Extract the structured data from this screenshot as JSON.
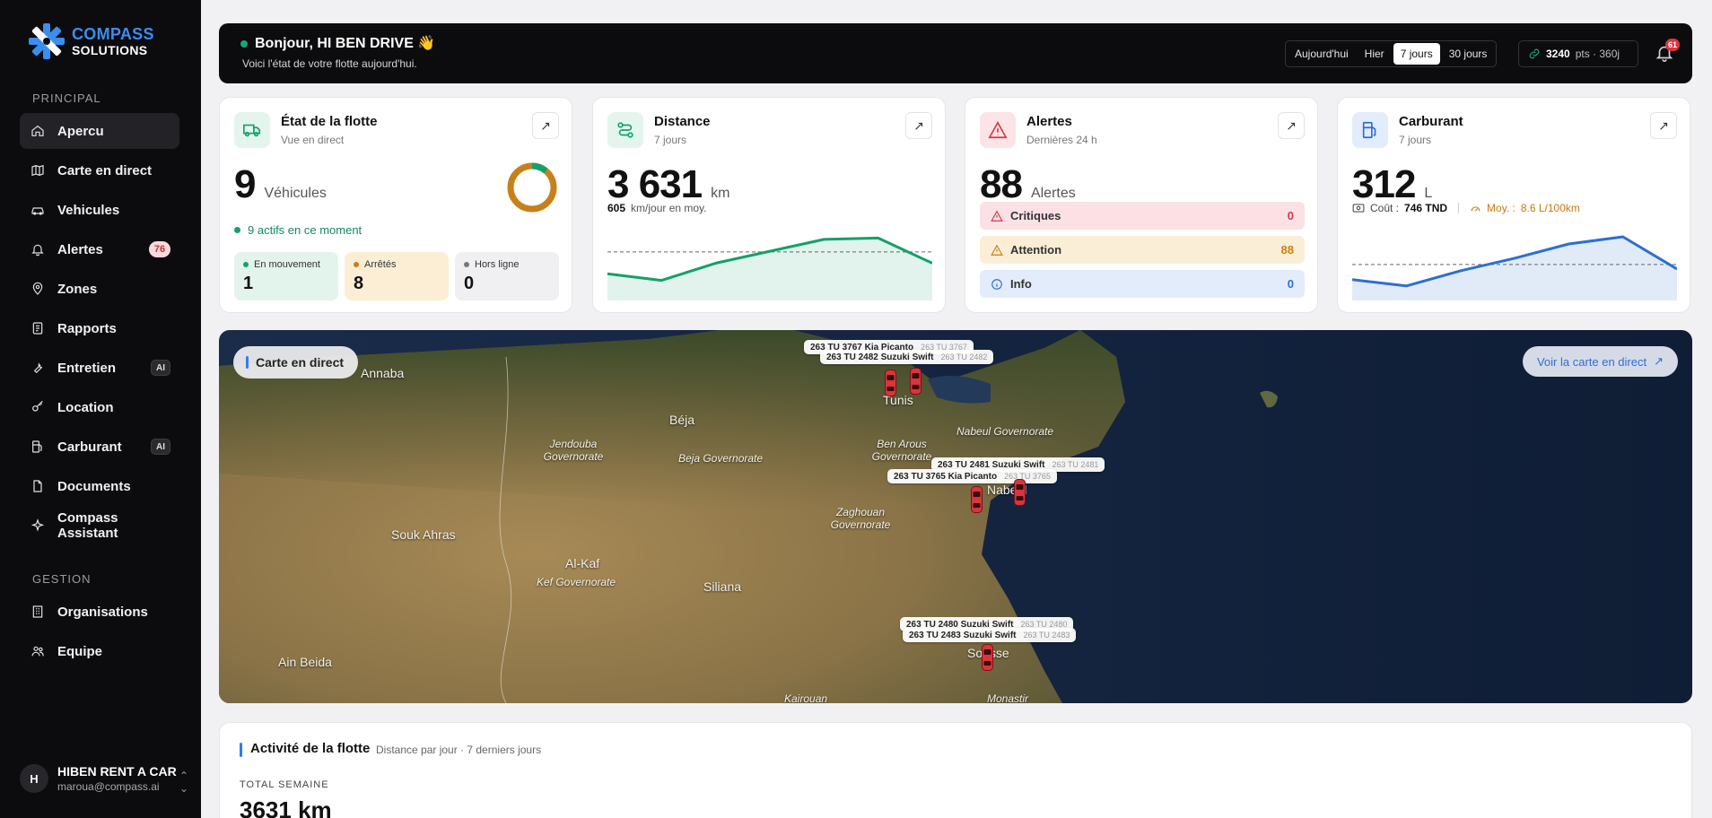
{
  "brand": {
    "line1": "COMPASS",
    "line2": "SOLUTIONS"
  },
  "sidebar": {
    "section_principal": "PRINCIPAL",
    "section_gestion": "GESTION",
    "items": [
      {
        "label": "Apercu",
        "icon": "home-icon"
      },
      {
        "label": "Carte en direct",
        "icon": "map-icon"
      },
      {
        "label": "Vehicules",
        "icon": "car-icon"
      },
      {
        "label": "Alertes",
        "icon": "bell-icon",
        "badge": "76"
      },
      {
        "label": "Zones",
        "icon": "pin-icon"
      },
      {
        "label": "Rapports",
        "icon": "report-icon"
      },
      {
        "label": "Entretien",
        "icon": "wrench-icon",
        "ai": "AI"
      },
      {
        "label": "Location",
        "icon": "key-icon"
      },
      {
        "label": "Carburant",
        "icon": "fuel-icon",
        "ai": "AI"
      },
      {
        "label": "Documents",
        "icon": "document-icon"
      },
      {
        "label": "Compass Assistant",
        "icon": "sparkle-icon"
      }
    ],
    "gestion_items": [
      {
        "label": "Organisations",
        "icon": "building-icon"
      },
      {
        "label": "Equipe",
        "icon": "team-icon"
      }
    ],
    "user": {
      "initial": "H",
      "name": "HIBEN RENT A CAR",
      "email": "maroua@compass.ai"
    }
  },
  "header": {
    "greeting": "Bonjour, HI BEN DRIVE 👋",
    "subtitle": "Voici l'état de votre flotte aujourd'hui.",
    "periods": [
      "Aujourd'hui",
      "Hier",
      "7 jours",
      "30 jours"
    ],
    "selected_period": "7 jours",
    "points_value": "3240",
    "points_unit": "pts · 360j",
    "notifications": "61"
  },
  "fleet": {
    "title": "État de la flotte",
    "subtitle": "Vue en direct",
    "count": "9",
    "unit": "Véhicules",
    "active_text": "9 actifs en ce moment",
    "moving_label": "En mouvement",
    "moving": "1",
    "stopped_label": "Arrêtés",
    "stopped": "8",
    "offline_label": "Hors ligne",
    "offline": "0",
    "moving_fraction": 0.111,
    "colors": {
      "moving": "#16a06a",
      "stopped": "#c7801a",
      "offline": "#777777"
    }
  },
  "distance": {
    "title": "Distance",
    "subtitle": "7 jours",
    "value": "3 631",
    "unit": "km",
    "avg_value": "605",
    "avg_label": "km/jour en moy.",
    "color": "#14a06a",
    "series": [
      440,
      390,
      520,
      610,
      700,
      710,
      520
    ],
    "average": 605
  },
  "alerts": {
    "title": "Alertes",
    "subtitle": "Dernières 24 h",
    "total": "88",
    "unit": "Alertes",
    "rows": [
      {
        "label": "Critiques",
        "value": "0"
      },
      {
        "label": "Attention",
        "value": "88"
      },
      {
        "label": "Info",
        "value": "0"
      }
    ]
  },
  "fuel": {
    "title": "Carburant",
    "subtitle": "7 jours",
    "value": "312",
    "unit": "L",
    "cost_label": "Coût :",
    "cost_value": "746 TND",
    "avg_label": "Moy. :",
    "avg_value": "8.6 L/100km",
    "color": "#2d6fd0",
    "series": [
      40,
      33,
      50,
      64,
      80,
      88,
      52
    ],
    "average": 57
  },
  "map": {
    "label": "Carte en direct",
    "open_button": "Voir la carte en direct",
    "places": [
      "Annaba",
      "Béja",
      "Jendouba Governorate",
      "Beja Governorate",
      "Ben Arous Governorate",
      "Nabeul Governorate",
      "Nabeul",
      "Zaghouan Governorate",
      "Souk Ahras",
      "Al-Kaf",
      "Kef Governorate",
      "Siliana",
      "Ain Beida",
      "Sousse",
      "Kairouan",
      "Monastir",
      "Tunis"
    ],
    "vehicles": [
      {
        "name": "263 TU 3767 Kia Picanto",
        "plate": "263 TU 3767"
      },
      {
        "name": "263 TU 2482 Suzuki Swift",
        "plate": "263 TU 2482"
      },
      {
        "name": "263 TU 2481 Suzuki Swift",
        "plate": "263 TU 2481"
      },
      {
        "name": "263 TU 3765 Kia Picanto",
        "plate": "263 TU 3765"
      },
      {
        "name": "263 TU 2480 Suzuki Swift",
        "plate": "263 TU 2480"
      },
      {
        "name": "263 TU 2483 Suzuki Swift",
        "plate": "263 TU 2483"
      }
    ]
  },
  "activity": {
    "title": "Activité de la flotte",
    "subtitle": "Distance par jour · 7 derniers jours",
    "total_label": "TOTAL SEMAINE",
    "total": "3631 km"
  }
}
